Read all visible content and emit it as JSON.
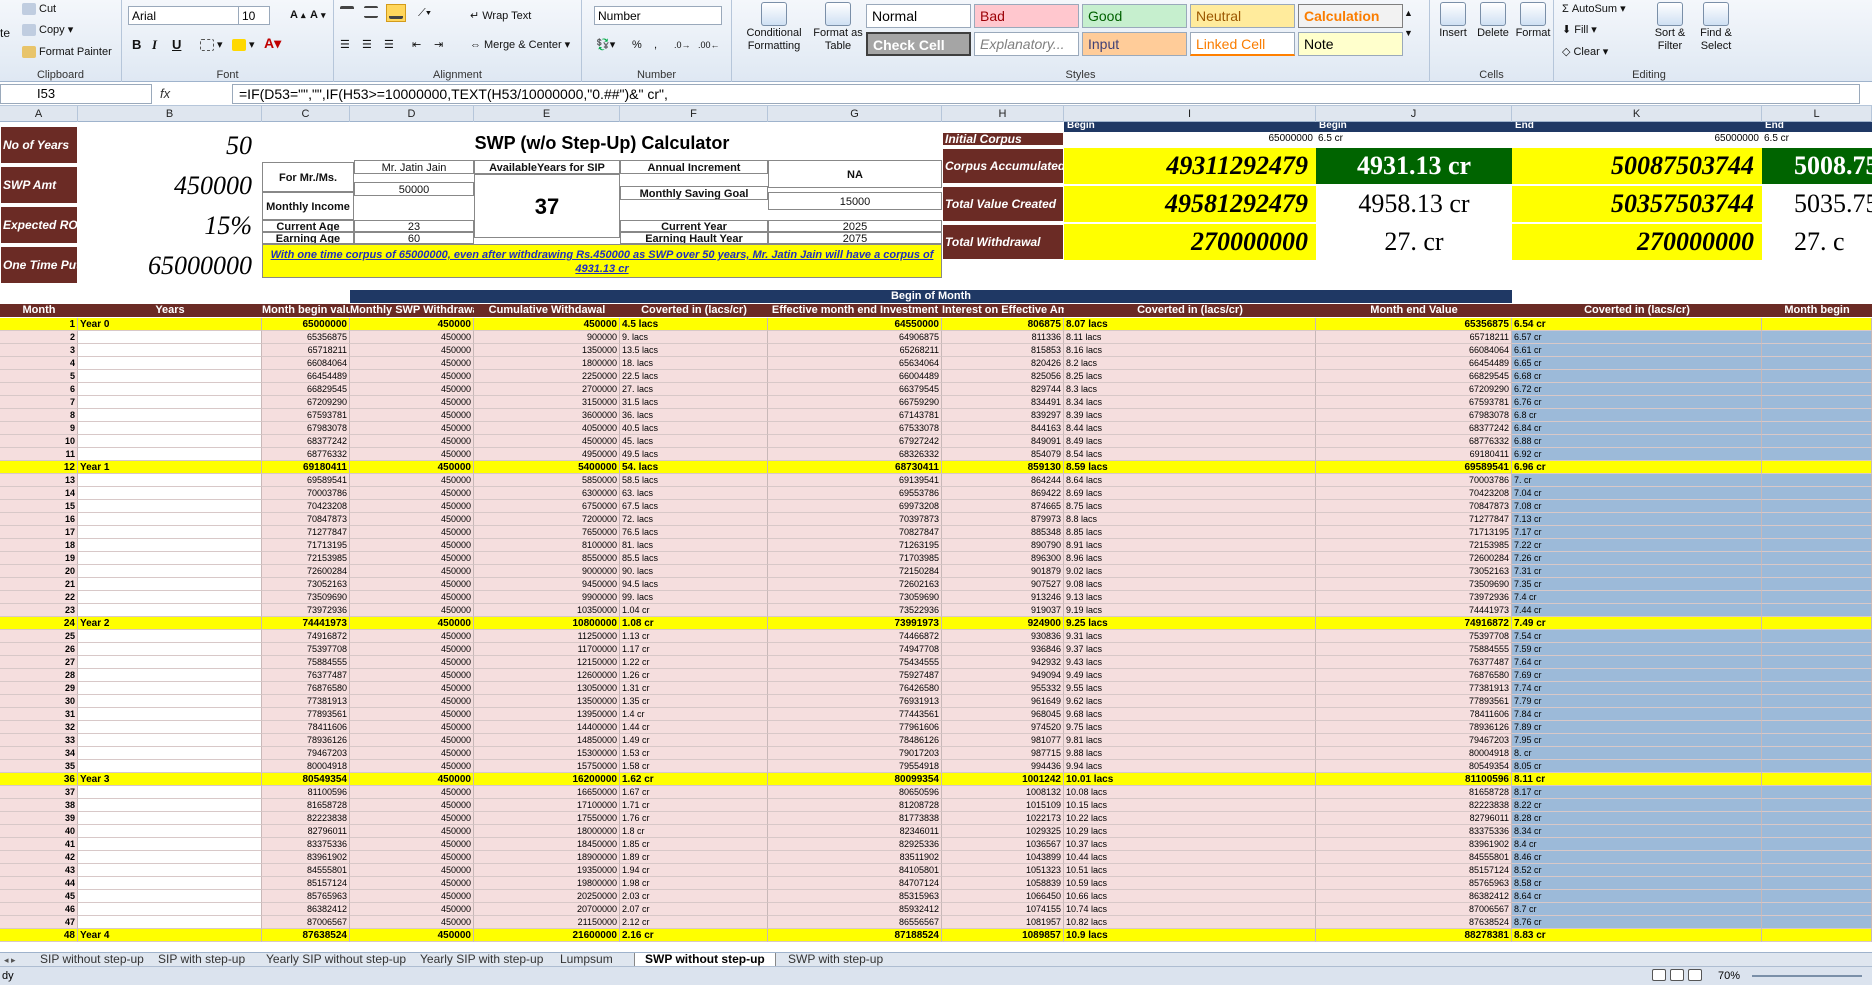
{
  "ribbon": {
    "clipboard": {
      "cut": "Cut",
      "copy": "Copy",
      "format_painter": "Format Painter",
      "paste": "te",
      "label": "Clipboard"
    },
    "font": {
      "name": "Arial",
      "size": "10",
      "bold": "B",
      "italic": "I",
      "underline": "U",
      "label": "Font"
    },
    "alignment": {
      "wrap": "Wrap Text",
      "merge": "Merge & Center",
      "label": "Alignment"
    },
    "number": {
      "format": "Number",
      "pct": "%",
      "comma": ",",
      "label": "Number"
    },
    "styles": {
      "cond": "Conditional Formatting",
      "table": "Format as Table",
      "cells": [
        "Normal",
        "Bad",
        "Good",
        "Neutral",
        "Calculation",
        "Check Cell",
        "Explanatory...",
        "Input",
        "Linked Cell",
        "Note"
      ],
      "label": "Styles"
    },
    "cells": {
      "insert": "Insert",
      "delete": "Delete",
      "format": "Format",
      "label": "Cells"
    },
    "editing": {
      "autosum": "AutoSum",
      "fill": "Fill",
      "clear": "Clear",
      "sort": "Sort & Filter",
      "find": "Find & Select",
      "label": "Editing"
    }
  },
  "formula_bar": {
    "name": "I53",
    "fx": "fx",
    "formula": "=IF(D53=\"\",\"\",IF(H53>=10000000,TEXT(H53/10000000,\"0.##\")&\" cr\","
  },
  "columns": [
    "A",
    "B",
    "C",
    "D",
    "E",
    "F",
    "G",
    "H",
    "I",
    "J",
    "K",
    "L"
  ],
  "top": {
    "title": "SWP (w/o Step-Up) Calculator",
    "labels": {
      "years": "No of Years",
      "swp": "SWP Amt",
      "roi": "Expected ROI",
      "otp": "One Time Put"
    },
    "values": {
      "years": "50",
      "swp": "450000",
      "roi": "15%",
      "otp": "65000000"
    },
    "for": "For Mr./Ms.",
    "name": "Mr. Jatin Jain",
    "avail": "AvailableYears for SIP",
    "annual": "Annual Increment",
    "na": "NA",
    "monthly_income": "Monthly Income",
    "monthly_income_v": "50000",
    "avail_v": "37",
    "saving_goal": "Monthly Saving Goal",
    "saving_goal_v": "15000",
    "age": "Current Age",
    "age_v": "23",
    "cur_year": "Current Year",
    "cur_year_v": "2025",
    "earn_age": "Earning Age",
    "earn_age_v": "60",
    "halt": "Earning Hault Year",
    "halt_v": "2075",
    "note": "With one time corpus of 65000000, even after withdrawing Rs.450000 as SWP over 50 years, Mr. Jatin Jain will have a corpus of 4931.13 cr",
    "summary": {
      "init": "Initial Corpus",
      "corpus": "Corpus Accumulated",
      "total": "Total Value Created",
      "withdraw": "Total Withdrawal",
      "begin": "Begin",
      "end": "End",
      "init_i": "65000000",
      "init_j": "6.5 cr",
      "init_k": "65000000",
      "init_l": "6.5 cr",
      "c_i": "49311292479",
      "c_j": "4931.13 cr",
      "c_k": "50087503744",
      "c_l": "5008.75",
      "t_i": "49581292479",
      "t_j": "4958.13 cr",
      "t_k": "50357503744",
      "t_l": "5035.75",
      "w_i": "270000000",
      "w_j": "27. cr",
      "w_k": "270000000",
      "w_l": "27. c"
    }
  },
  "begin_of_month": "Begin of Month",
  "headers": [
    "Month",
    "Years",
    "Month begin value",
    "Monthly SWP Withdrawal",
    "Cumulative Withdawal",
    "Coverted in (lacs/cr)",
    "Effective month end Investment",
    "Interest on Effective Am",
    "Coverted in (lacs/cr)",
    "Month end Value",
    "Coverted in (lacs/cr)",
    "Month begin"
  ],
  "rows": [
    [
      "1",
      "Year 0",
      "65000000",
      "450000",
      "450000",
      "4.5 lacs",
      "64550000",
      "806875",
      "8.07 lacs",
      "65356875",
      "6.54 cr"
    ],
    [
      "2",
      "",
      "65356875",
      "450000",
      "900000",
      "9. lacs",
      "64906875",
      "811336",
      "8.11 lacs",
      "65718211",
      "6.57 cr"
    ],
    [
      "3",
      "",
      "65718211",
      "450000",
      "1350000",
      "13.5 lacs",
      "65268211",
      "815853",
      "8.16 lacs",
      "66084064",
      "6.61 cr"
    ],
    [
      "4",
      "",
      "66084064",
      "450000",
      "1800000",
      "18. lacs",
      "65634064",
      "820426",
      "8.2 lacs",
      "66454489",
      "6.65 cr"
    ],
    [
      "5",
      "",
      "66454489",
      "450000",
      "2250000",
      "22.5 lacs",
      "66004489",
      "825056",
      "8.25 lacs",
      "66829545",
      "6.68 cr"
    ],
    [
      "6",
      "",
      "66829545",
      "450000",
      "2700000",
      "27. lacs",
      "66379545",
      "829744",
      "8.3 lacs",
      "67209290",
      "6.72 cr"
    ],
    [
      "7",
      "",
      "67209290",
      "450000",
      "3150000",
      "31.5 lacs",
      "66759290",
      "834491",
      "8.34 lacs",
      "67593781",
      "6.76 cr"
    ],
    [
      "8",
      "",
      "67593781",
      "450000",
      "3600000",
      "36. lacs",
      "67143781",
      "839297",
      "8.39 lacs",
      "67983078",
      "6.8 cr"
    ],
    [
      "9",
      "",
      "67983078",
      "450000",
      "4050000",
      "40.5 lacs",
      "67533078",
      "844163",
      "8.44 lacs",
      "68377242",
      "6.84 cr"
    ],
    [
      "10",
      "",
      "68377242",
      "450000",
      "4500000",
      "45. lacs",
      "67927242",
      "849091",
      "8.49 lacs",
      "68776332",
      "6.88 cr"
    ],
    [
      "11",
      "",
      "68776332",
      "450000",
      "4950000",
      "49.5 lacs",
      "68326332",
      "854079",
      "8.54 lacs",
      "69180411",
      "6.92 cr"
    ],
    [
      "12",
      "Year 1",
      "69180411",
      "450000",
      "5400000",
      "54. lacs",
      "68730411",
      "859130",
      "8.59 lacs",
      "69589541",
      "6.96 cr"
    ],
    [
      "13",
      "",
      "69589541",
      "450000",
      "5850000",
      "58.5 lacs",
      "69139541",
      "864244",
      "8.64 lacs",
      "70003786",
      "7. cr"
    ],
    [
      "14",
      "",
      "70003786",
      "450000",
      "6300000",
      "63. lacs",
      "69553786",
      "869422",
      "8.69 lacs",
      "70423208",
      "7.04 cr"
    ],
    [
      "15",
      "",
      "70423208",
      "450000",
      "6750000",
      "67.5 lacs",
      "69973208",
      "874665",
      "8.75 lacs",
      "70847873",
      "7.08 cr"
    ],
    [
      "16",
      "",
      "70847873",
      "450000",
      "7200000",
      "72. lacs",
      "70397873",
      "879973",
      "8.8 lacs",
      "71277847",
      "7.13 cr"
    ],
    [
      "17",
      "",
      "71277847",
      "450000",
      "7650000",
      "76.5 lacs",
      "70827847",
      "885348",
      "8.85 lacs",
      "71713195",
      "7.17 cr"
    ],
    [
      "18",
      "",
      "71713195",
      "450000",
      "8100000",
      "81. lacs",
      "71263195",
      "890790",
      "8.91 lacs",
      "72153985",
      "7.22 cr"
    ],
    [
      "19",
      "",
      "72153985",
      "450000",
      "8550000",
      "85.5 lacs",
      "71703985",
      "896300",
      "8.96 lacs",
      "72600284",
      "7.26 cr"
    ],
    [
      "20",
      "",
      "72600284",
      "450000",
      "9000000",
      "90. lacs",
      "72150284",
      "901879",
      "9.02 lacs",
      "73052163",
      "7.31 cr"
    ],
    [
      "21",
      "",
      "73052163",
      "450000",
      "9450000",
      "94.5 lacs",
      "72602163",
      "907527",
      "9.08 lacs",
      "73509690",
      "7.35 cr"
    ],
    [
      "22",
      "",
      "73509690",
      "450000",
      "9900000",
      "99. lacs",
      "73059690",
      "913246",
      "9.13 lacs",
      "73972936",
      "7.4 cr"
    ],
    [
      "23",
      "",
      "73972936",
      "450000",
      "10350000",
      "1.04 cr",
      "73522936",
      "919037",
      "9.19 lacs",
      "74441973",
      "7.44 cr"
    ],
    [
      "24",
      "Year 2",
      "74441973",
      "450000",
      "10800000",
      "1.08 cr",
      "73991973",
      "924900",
      "9.25 lacs",
      "74916872",
      "7.49 cr"
    ],
    [
      "25",
      "",
      "74916872",
      "450000",
      "11250000",
      "1.13 cr",
      "74466872",
      "930836",
      "9.31 lacs",
      "75397708",
      "7.54 cr"
    ],
    [
      "26",
      "",
      "75397708",
      "450000",
      "11700000",
      "1.17 cr",
      "74947708",
      "936846",
      "9.37 lacs",
      "75884555",
      "7.59 cr"
    ],
    [
      "27",
      "",
      "75884555",
      "450000",
      "12150000",
      "1.22 cr",
      "75434555",
      "942932",
      "9.43 lacs",
      "76377487",
      "7.64 cr"
    ],
    [
      "28",
      "",
      "76377487",
      "450000",
      "12600000",
      "1.26 cr",
      "75927487",
      "949094",
      "9.49 lacs",
      "76876580",
      "7.69 cr"
    ],
    [
      "29",
      "",
      "76876580",
      "450000",
      "13050000",
      "1.31 cr",
      "76426580",
      "955332",
      "9.55 lacs",
      "77381913",
      "7.74 cr"
    ],
    [
      "30",
      "",
      "77381913",
      "450000",
      "13500000",
      "1.35 cr",
      "76931913",
      "961649",
      "9.62 lacs",
      "77893561",
      "7.79 cr"
    ],
    [
      "31",
      "",
      "77893561",
      "450000",
      "13950000",
      "1.4 cr",
      "77443561",
      "968045",
      "9.68 lacs",
      "78411606",
      "7.84 cr"
    ],
    [
      "32",
      "",
      "78411606",
      "450000",
      "14400000",
      "1.44 cr",
      "77961606",
      "974520",
      "9.75 lacs",
      "78936126",
      "7.89 cr"
    ],
    [
      "33",
      "",
      "78936126",
      "450000",
      "14850000",
      "1.49 cr",
      "78486126",
      "981077",
      "9.81 lacs",
      "79467203",
      "7.95 cr"
    ],
    [
      "34",
      "",
      "79467203",
      "450000",
      "15300000",
      "1.53 cr",
      "79017203",
      "987715",
      "9.88 lacs",
      "80004918",
      "8. cr"
    ],
    [
      "35",
      "",
      "80004918",
      "450000",
      "15750000",
      "1.58 cr",
      "79554918",
      "994436",
      "9.94 lacs",
      "80549354",
      "8.05 cr"
    ],
    [
      "36",
      "Year 3",
      "80549354",
      "450000",
      "16200000",
      "1.62 cr",
      "80099354",
      "1001242",
      "10.01 lacs",
      "81100596",
      "8.11 cr"
    ],
    [
      "37",
      "",
      "81100596",
      "450000",
      "16650000",
      "1.67 cr",
      "80650596",
      "1008132",
      "10.08 lacs",
      "81658728",
      "8.17 cr"
    ],
    [
      "38",
      "",
      "81658728",
      "450000",
      "17100000",
      "1.71 cr",
      "81208728",
      "1015109",
      "10.15 lacs",
      "82223838",
      "8.22 cr"
    ],
    [
      "39",
      "",
      "82223838",
      "450000",
      "17550000",
      "1.76 cr",
      "81773838",
      "1022173",
      "10.22 lacs",
      "82796011",
      "8.28 cr"
    ],
    [
      "40",
      "",
      "82796011",
      "450000",
      "18000000",
      "1.8 cr",
      "82346011",
      "1029325",
      "10.29 lacs",
      "83375336",
      "8.34 cr"
    ],
    [
      "41",
      "",
      "83375336",
      "450000",
      "18450000",
      "1.85 cr",
      "82925336",
      "1036567",
      "10.37 lacs",
      "83961902",
      "8.4 cr"
    ],
    [
      "42",
      "",
      "83961902",
      "450000",
      "18900000",
      "1.89 cr",
      "83511902",
      "1043899",
      "10.44 lacs",
      "84555801",
      "8.46 cr"
    ],
    [
      "43",
      "",
      "84555801",
      "450000",
      "19350000",
      "1.94 cr",
      "84105801",
      "1051323",
      "10.51 lacs",
      "85157124",
      "8.52 cr"
    ],
    [
      "44",
      "",
      "85157124",
      "450000",
      "19800000",
      "1.98 cr",
      "84707124",
      "1058839",
      "10.59 lacs",
      "85765963",
      "8.58 cr"
    ],
    [
      "45",
      "",
      "85765963",
      "450000",
      "20250000",
      "2.03 cr",
      "85315963",
      "1066450",
      "10.66 lacs",
      "86382412",
      "8.64 cr"
    ],
    [
      "46",
      "",
      "86382412",
      "450000",
      "20700000",
      "2.07 cr",
      "85932412",
      "1074155",
      "10.74 lacs",
      "87006567",
      "8.7 cr"
    ],
    [
      "47",
      "",
      "87006567",
      "450000",
      "21150000",
      "2.12 cr",
      "86556567",
      "1081957",
      "10.82 lacs",
      "87638524",
      "8.76 cr"
    ],
    [
      "48",
      "Year 4",
      "87638524",
      "450000",
      "21600000",
      "2.16 cr",
      "87188524",
      "1089857",
      "10.9 lacs",
      "88278381",
      "8.83 cr"
    ]
  ],
  "sheet_tabs": [
    "SIP without step-up",
    "SIP with step-up",
    "Yearly SIP without step-up",
    "Yearly SIP with step-up",
    "Lumpsum",
    "SWP without step-up",
    "SWP with step-up"
  ],
  "active_tab": "SWP without step-up",
  "status": {
    "left": "dy",
    "zoom": "70%"
  }
}
